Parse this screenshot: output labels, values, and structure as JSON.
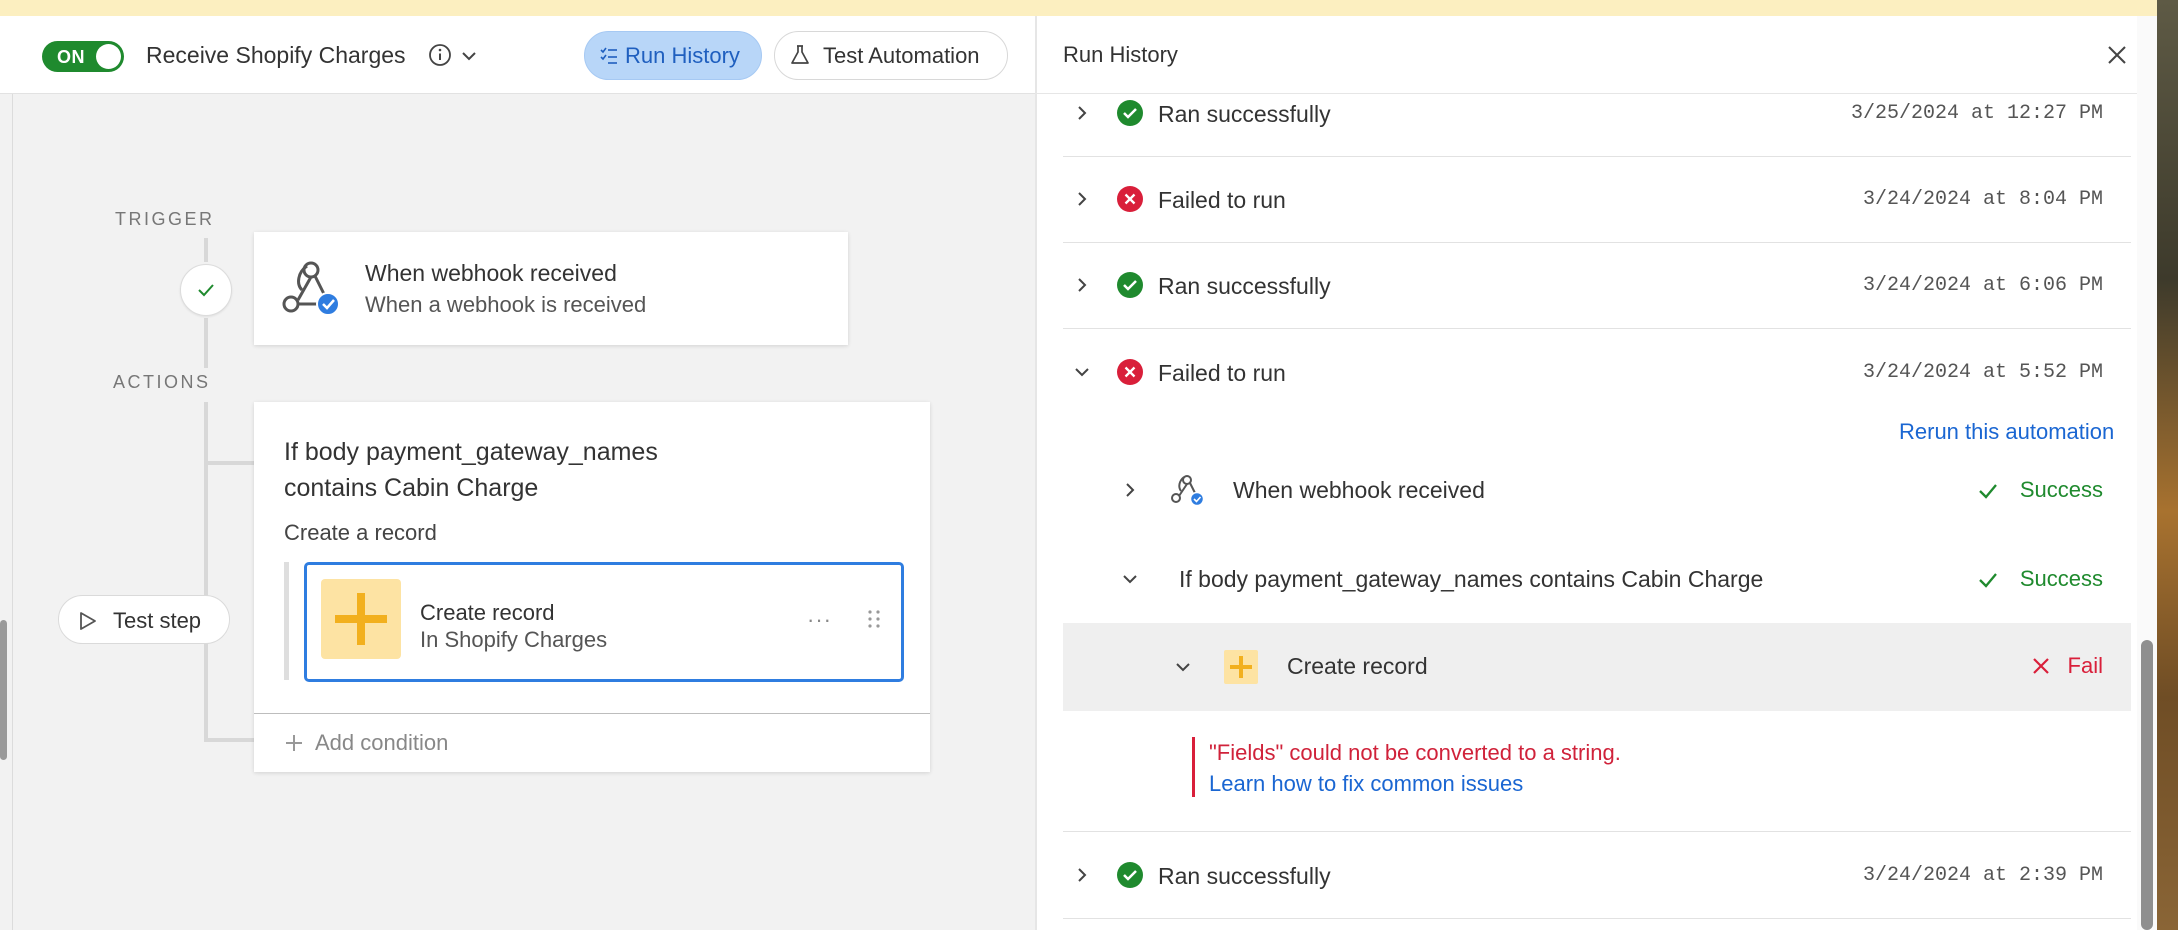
{
  "toolbar": {
    "toggle_label": "ON",
    "automation_name": "Receive Shopify Charges",
    "run_history_button": "Run History",
    "test_automation_button": "Test Automation"
  },
  "canvas": {
    "trigger_label": "TRIGGER",
    "actions_label": "ACTIONS",
    "trigger_card": {
      "title": "When webhook received",
      "subtitle": "When a webhook is received"
    },
    "condition_card": {
      "title": "If body payment_gateway_names contains Cabin Charge",
      "subtitle": "Create a record",
      "record": {
        "title": "Create record",
        "subtitle": "In Shopify Charges",
        "menu": "···"
      },
      "add_condition": "Add condition"
    },
    "test_step_button": "Test step"
  },
  "run_history": {
    "title": "Run History",
    "runs": [
      {
        "status": "Ran successfully",
        "timestamp": "3/25/2024 at 12:27 PM",
        "result": "success"
      },
      {
        "status": "Failed to run",
        "timestamp": "3/24/2024 at 8:04 PM",
        "result": "fail"
      },
      {
        "status": "Ran successfully",
        "timestamp": "3/24/2024 at 6:06 PM",
        "result": "success"
      },
      {
        "status": "Failed to run",
        "timestamp": "3/24/2024 at 5:52 PM",
        "result": "fail"
      },
      {
        "status": "Ran successfully",
        "timestamp": "3/24/2024 at 2:39 PM",
        "result": "success"
      }
    ],
    "rerun_link": "Rerun this automation",
    "steps": [
      {
        "label": "When webhook received",
        "result": "Success"
      },
      {
        "label": "If body payment_gateway_names contains Cabin Charge",
        "result": "Success"
      },
      {
        "label": "Create record",
        "result": "Fail"
      }
    ],
    "error": {
      "message": "\"Fields\" could not be converted to a string.",
      "help_link": "Learn how to fix common issues"
    }
  },
  "colors": {
    "success_green": "#1f8a2e",
    "fail_red": "#d91f3a",
    "link_blue": "#1a66d2",
    "record_yellow": "#f2b01e"
  }
}
